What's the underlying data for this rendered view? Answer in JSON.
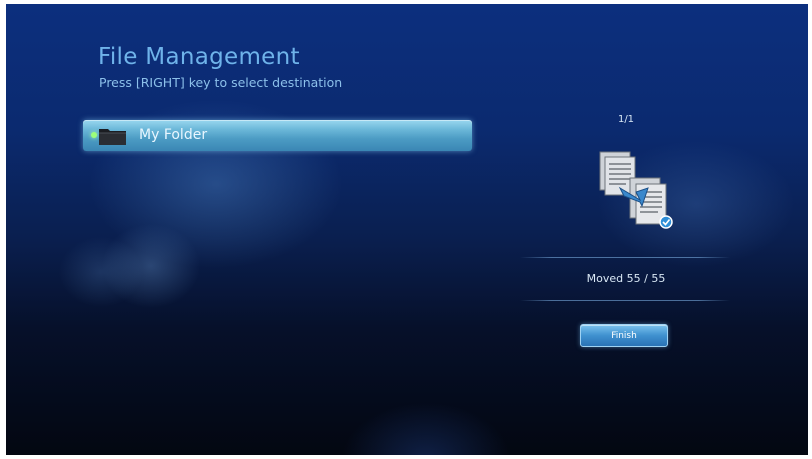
{
  "header": {
    "title": "File Management",
    "instruction": "Press [RIGHT] key to select destination"
  },
  "folder_list": {
    "items": [
      {
        "label": "My Folder",
        "icon": "folder-icon",
        "selected": true
      }
    ]
  },
  "progress_panel": {
    "page_indicator": "1/1",
    "icon": "copy-complete-icon",
    "status": "Moved 55 / 55",
    "moved": 55,
    "total": 55,
    "finish_label": "Finish"
  },
  "colors": {
    "title": "#6fb3ea",
    "selection_highlight": "#6cb8d9",
    "button": "#3f91cf",
    "background_top": "#0c2f7e",
    "background_bottom": "#030711"
  }
}
